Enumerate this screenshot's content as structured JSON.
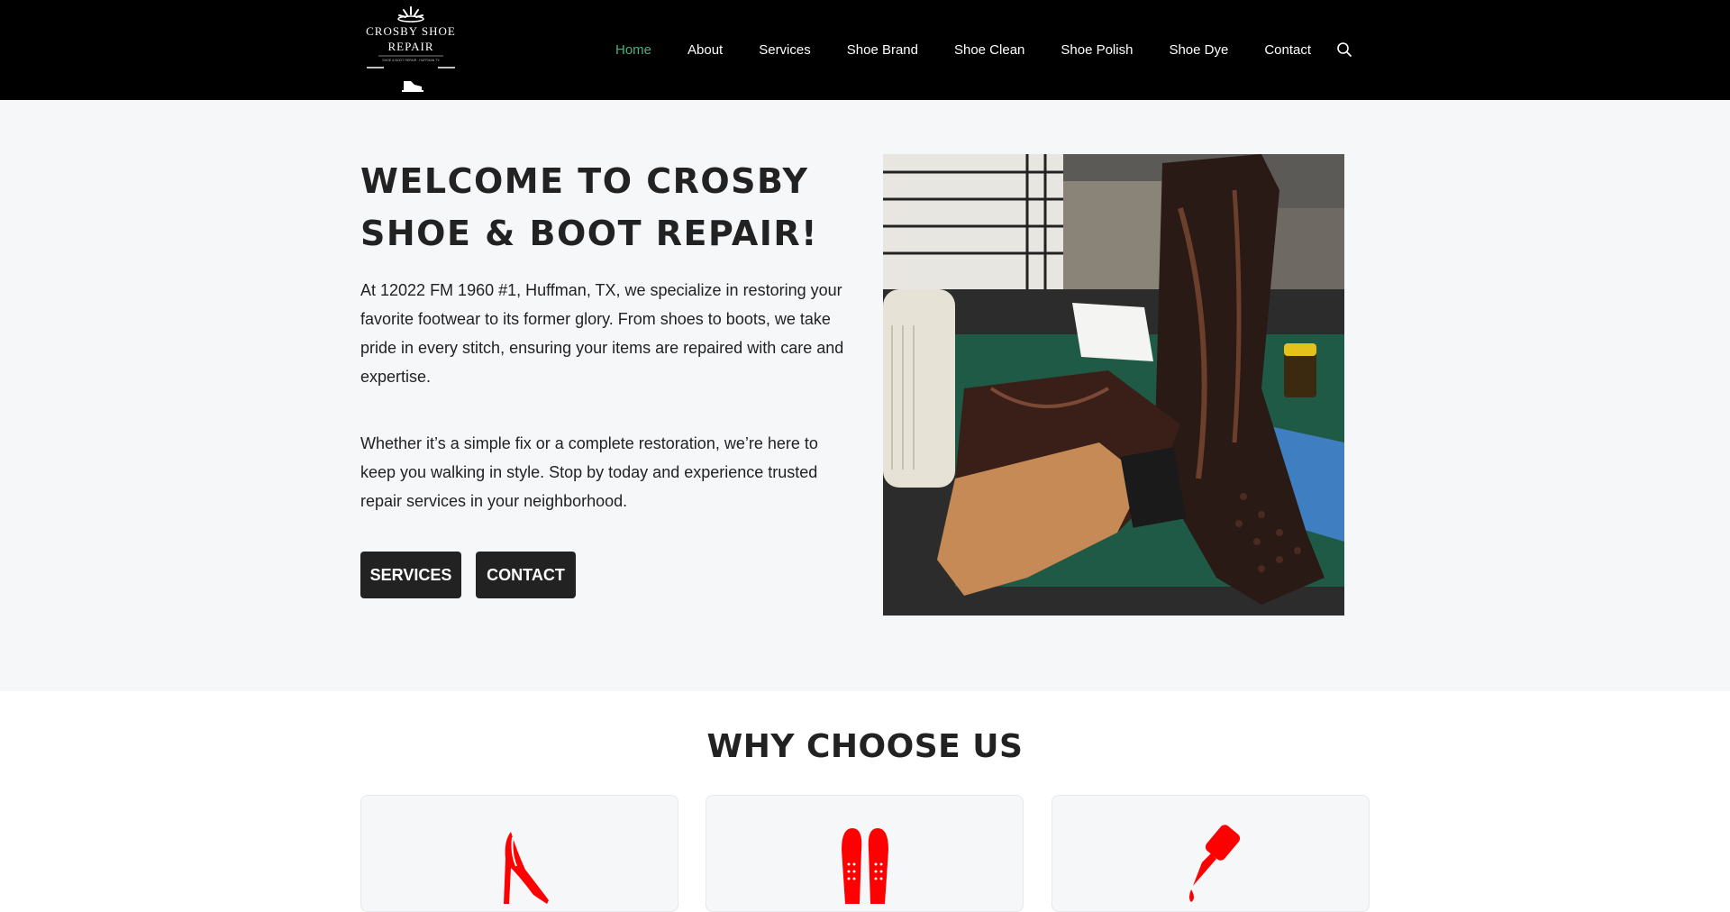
{
  "header": {
    "logo": {
      "line1": "CROSBY SHOE",
      "line2": "REPAIR",
      "tagline": "SHOE & BOOT REPAIR · HUFFMAN TX"
    },
    "nav": [
      {
        "label": "Home",
        "active": true
      },
      {
        "label": "About"
      },
      {
        "label": "Services"
      },
      {
        "label": "Shoe Brand"
      },
      {
        "label": "Shoe Clean"
      },
      {
        "label": "Shoe Polish"
      },
      {
        "label": "Shoe Dye"
      },
      {
        "label": "Contact"
      }
    ],
    "search_icon": "search-icon"
  },
  "hero": {
    "title": "WELCOME TO CROSBY SHOE & BOOT REPAIR!",
    "paragraph1": "At 12022 FM 1960 #1, Huffman, TX, we specialize in restoring your favorite footwear to its former glory. From shoes to boots, we take pride in every stitch, ensuring your items are repaired with care and expertise.",
    "paragraph2": "Whether it’s a simple fix or a complete restoration, we’re here to keep you walking in style. Stop by today and experience trusted repair services in your neighborhood.",
    "buttons": {
      "services": "SERVICES",
      "contact": "CONTACT"
    },
    "image_subject": "cowboy boots on workbench"
  },
  "why": {
    "title": "WHY CHOOSE US",
    "cards": [
      {
        "icon": "high-heel-icon"
      },
      {
        "icon": "insoles-icon"
      },
      {
        "icon": "glue-bottle-icon"
      }
    ]
  },
  "colors": {
    "header_bg": "#000000",
    "active_nav": "#4caf7d",
    "hero_bg": "#f6f7f9",
    "button_bg": "#222222",
    "icon_red": "#ff0000"
  }
}
